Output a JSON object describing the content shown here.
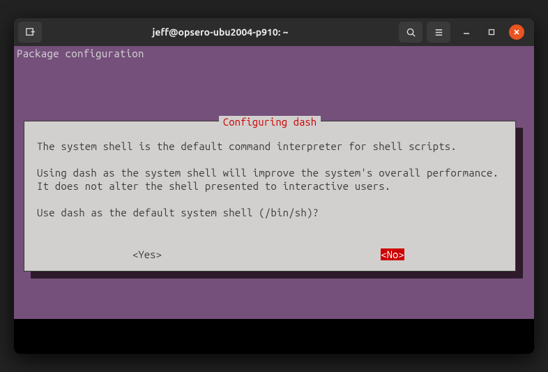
{
  "window": {
    "title": "jeff@opsero-ubu2004-p910: ~"
  },
  "terminal": {
    "header": "Package configuration"
  },
  "dialog": {
    "title": "Configuring dash",
    "para1": "The system shell is the default command interpreter for shell scripts.",
    "para2": "Using dash as the system shell will improve the system's overall performance. It does not alter the shell presented to interactive users.",
    "question": "Use dash as the default system shell (/bin/sh)?",
    "yes": "<Yes>",
    "no": "<No>"
  }
}
